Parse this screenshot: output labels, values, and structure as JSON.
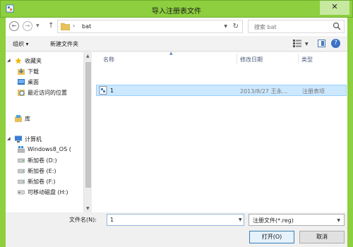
{
  "window": {
    "title": "导入注册表文件"
  },
  "address": {
    "path_segment": "bat",
    "search_placeholder": "搜索 bat"
  },
  "toolbar": {
    "organize_label": "组织 ▾",
    "new_folder_label": "新建文件夹"
  },
  "nav_pane": {
    "favorites_label": "收藏夹",
    "favorites": [
      {
        "label": "下载",
        "icon": "download-folder-icon"
      },
      {
        "label": "桌面",
        "icon": "desktop-icon"
      },
      {
        "label": "最近访问的位置",
        "icon": "recent-places-icon"
      }
    ],
    "libraries_label": "库",
    "computer_label": "计算机",
    "drives": [
      {
        "label": "Windows8_OS (",
        "icon": "windows-drive-icon"
      },
      {
        "label": "新加卷 (D:)",
        "icon": "drive-icon"
      },
      {
        "label": "新加卷 (E:)",
        "icon": "drive-icon"
      },
      {
        "label": "新加卷 (F:)",
        "icon": "drive-icon"
      },
      {
        "label": "可移动磁盘 (H:)",
        "icon": "removable-drive-icon"
      }
    ]
  },
  "file_list": {
    "columns": [
      "名称",
      "修改日期",
      "类型"
    ],
    "rows": [
      {
        "name": "1",
        "modified": "2013/8/27 王永...",
        "type": "注册表项"
      }
    ]
  },
  "bottom": {
    "filename_label": "文件名(N):",
    "filename_value": "1",
    "filetype_value": "注册文件(*.reg)",
    "open_label": "打开(O)",
    "cancel_label": "取消"
  },
  "colors": {
    "titlebar": "#8dcf3f",
    "selection": "#cce8ff"
  }
}
